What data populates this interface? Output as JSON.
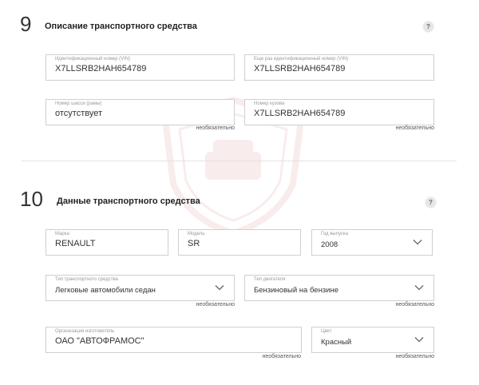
{
  "section9": {
    "number": "9",
    "title": "Описание транспортного средства",
    "help": "?",
    "fields": [
      {
        "label": "Идентификационный номер (VIN)",
        "value": "X7LLSRB2HAH654789"
      },
      {
        "label": "Еще раз идентификационный номер (VIN)",
        "value": "X7LLSRB2HAH654789"
      },
      {
        "label": "Номер шасси (рамы)",
        "value": "отсутствует",
        "optional": "необязательно"
      },
      {
        "label": "Номер кузова",
        "value": "X7LLSRB2HAH654789",
        "optional": "необязательно"
      }
    ]
  },
  "section10": {
    "number": "10",
    "title": "Данные транспортного средства",
    "help": "?",
    "fields": [
      {
        "label": "Марка",
        "value": "RENAULT"
      },
      {
        "label": "Модель",
        "value": "SR"
      },
      {
        "label": "Год выпуска",
        "value": "2008"
      },
      {
        "label": "Тип транспортного средства",
        "value": "Легковые автомобили седан",
        "optional": "необязательно"
      },
      {
        "label": "Тип двигателя",
        "value": "Бензиновый на бензине",
        "optional": "необязательно"
      },
      {
        "label": "Организация изготовитель",
        "value": "ОАО \"АВТОФРАМОС\"",
        "optional": "необязательно"
      },
      {
        "label": "Цвет",
        "value": "Красный",
        "optional": "необязательно"
      }
    ]
  },
  "colors": {
    "border": "#cfcfcf",
    "label": "#9a9a9a",
    "text": "#333333"
  },
  "icons": {
    "help": "question-circle-icon",
    "dropdown": "chevron-down-icon",
    "watermark": "shield-logo-icon"
  }
}
